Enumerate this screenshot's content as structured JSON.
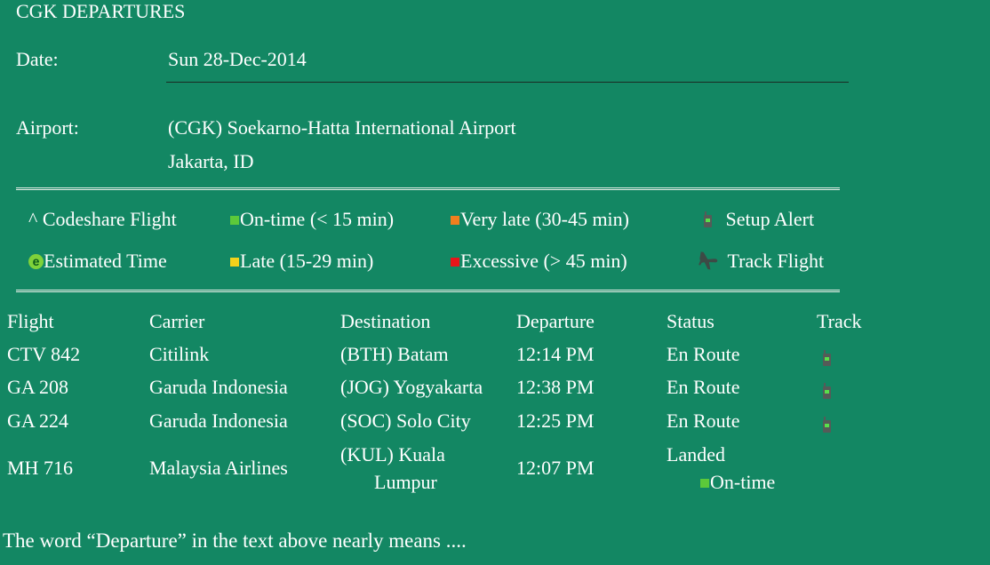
{
  "page": {
    "title": "CGK DEPARTURES",
    "date_label": "Date:",
    "date_value": "Sun 28-Dec-2014",
    "airport_label": "Airport:",
    "airport_name": "(CGK) Soekarno-Hatta International Airport",
    "airport_city": "Jakarta, ID"
  },
  "legend": {
    "codeshare": "^ Codeshare Flight",
    "estimated": "Estimated Time",
    "ontime": "On-time (< 15 min)",
    "late": "Late (15-29 min)",
    "very_late": "Very late (30-45 min)",
    "excessive": "Excessive (> 45 min)",
    "setup_alert": "Setup Alert",
    "track_flight": "Track Flight"
  },
  "colors": {
    "background": "#138763",
    "ontime": "#5cc93a",
    "late": "#f2d21b",
    "very_late": "#f07f1e",
    "excessive": "#e8141a"
  },
  "table": {
    "headers": [
      "Flight",
      "Carrier",
      "Destination",
      "Departure",
      "Status",
      "Track"
    ],
    "rows": [
      {
        "flight": "CTV 842",
        "carrier": "Citilink",
        "destination": "(BTH) Batam",
        "departure": "12:14 PM",
        "status": "En Route"
      },
      {
        "flight": "GA 208",
        "carrier": "Garuda Indonesia",
        "destination": "(JOG) Yogyakarta",
        "departure": "12:38 PM",
        "status": "En Route"
      },
      {
        "flight": "GA 224",
        "carrier": "Garuda Indonesia",
        "destination": "(SOC) Solo City",
        "departure": "12:25 PM",
        "status": "En Route"
      },
      {
        "flight": "MH 716",
        "carrier": "Malaysia Airlines",
        "destination_line1": "(KUL) Kuala",
        "destination_line2": "Lumpur",
        "departure": "12:07 PM",
        "status": "Landed",
        "status_note": "On-time"
      }
    ]
  },
  "question": "The word “Departure” in the text above nearly means ...."
}
